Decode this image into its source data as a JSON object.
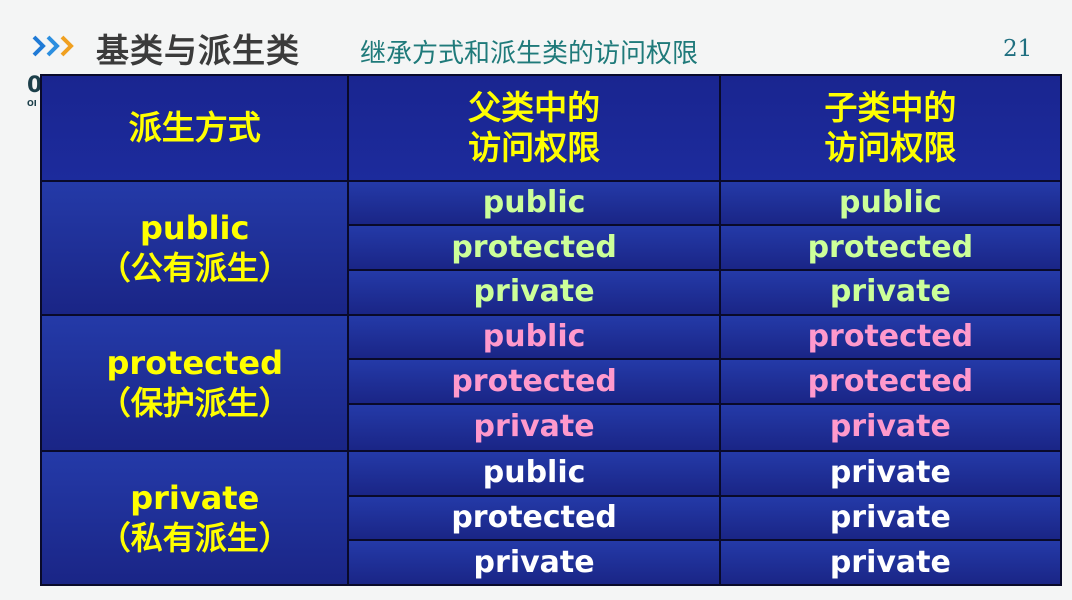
{
  "header": {
    "title": "基类与派生类",
    "subtitle": "继承方式和派生类的访问权限",
    "page_number": "21",
    "logo_fragment": "0",
    "logo_small": "OI",
    "colors": {
      "arrows": "#1f7ad6",
      "title": "#3b3b3b",
      "subtitle": "#1f7a7a"
    }
  },
  "table": {
    "headers": {
      "mode": "派生方式",
      "parent_line1": "父类中的",
      "parent_line2": "访问权限",
      "child_line1": "子类中的",
      "child_line2": "访问权限"
    },
    "groups": [
      {
        "mode": "public",
        "mode_cn": "（公有派生）",
        "color": "#ccff99",
        "rows": [
          {
            "parent": "public",
            "child": "public"
          },
          {
            "parent": "protected",
            "child": "protected"
          },
          {
            "parent": "private",
            "child": "private"
          }
        ]
      },
      {
        "mode": "protected",
        "mode_cn": "（保护派生）",
        "color": "#ff99cc",
        "rows": [
          {
            "parent": "public",
            "child": "protected"
          },
          {
            "parent": "protected",
            "child": "protected"
          },
          {
            "parent": "private",
            "child": "private"
          }
        ]
      },
      {
        "mode": "private",
        "mode_cn": "（私有派生）",
        "color": "#ffffff",
        "rows": [
          {
            "parent": "public",
            "child": "private"
          },
          {
            "parent": "protected",
            "child": "private"
          },
          {
            "parent": "private",
            "child": "private"
          }
        ]
      }
    ],
    "colors": {
      "header_text": "#ffff00",
      "mode_text": "#ffff00",
      "background": "#1c2a9e"
    }
  }
}
